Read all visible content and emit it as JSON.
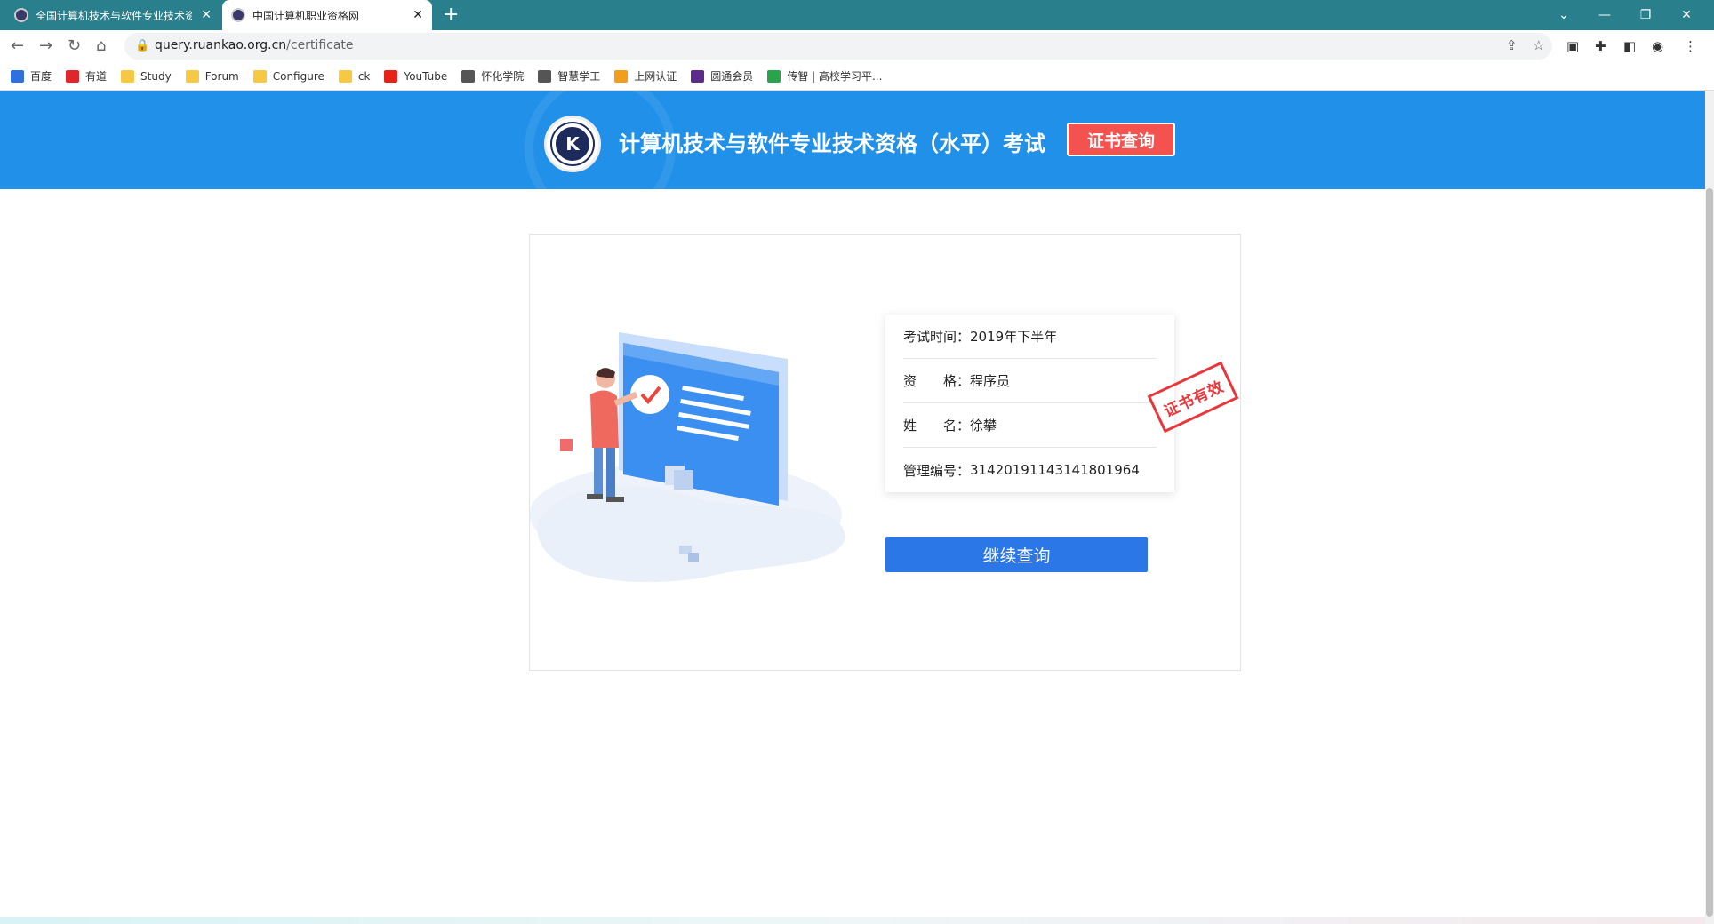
{
  "browser": {
    "tabs": [
      {
        "title": "全国计算机技术与软件专业技术资格（水平）考试",
        "active": false
      },
      {
        "title": "中国计算机职业资格网",
        "active": true
      }
    ],
    "new_tab_icon": "plus-icon",
    "url_host": "query.ruankao.org.cn",
    "url_path": "/certificate",
    "bookmarks": [
      {
        "label": "百度",
        "icon_color": "#2f6fe0"
      },
      {
        "label": "有道",
        "icon_color": "#e0262b"
      },
      {
        "label": "Study",
        "icon_color": "#f6c945"
      },
      {
        "label": "Forum",
        "icon_color": "#f6c945"
      },
      {
        "label": "Configure",
        "icon_color": "#f6c945"
      },
      {
        "label": "ck",
        "icon_color": "#f6c945"
      },
      {
        "label": "YouTube",
        "icon_color": "#e62117"
      },
      {
        "label": "怀化学院",
        "icon_color": "#555555"
      },
      {
        "label": "智慧学工",
        "icon_color": "#555555"
      },
      {
        "label": "上网认证",
        "icon_color": "#f29d1c"
      },
      {
        "label": "圆通会员",
        "icon_color": "#5b2c8c"
      },
      {
        "label": "传智 | 高校学习平...",
        "icon_color": "#2aa34a"
      }
    ]
  },
  "header": {
    "title": "计算机技术与软件专业技术资格（水平）考试",
    "cert_button": "证书查询",
    "logo_letter": "K",
    "bg_color": "#2190e8"
  },
  "result": {
    "exam_time_label": "考试时间：",
    "exam_time": "2019年下半年",
    "qual_label": "资　　格：",
    "qualification": "程序员",
    "name_label": "姓　　名：",
    "name": "徐攀",
    "id_label": "管理编号：",
    "management_no": "31420191143141801964",
    "stamp_text": "证书有效",
    "continue_button": "继续查询"
  }
}
